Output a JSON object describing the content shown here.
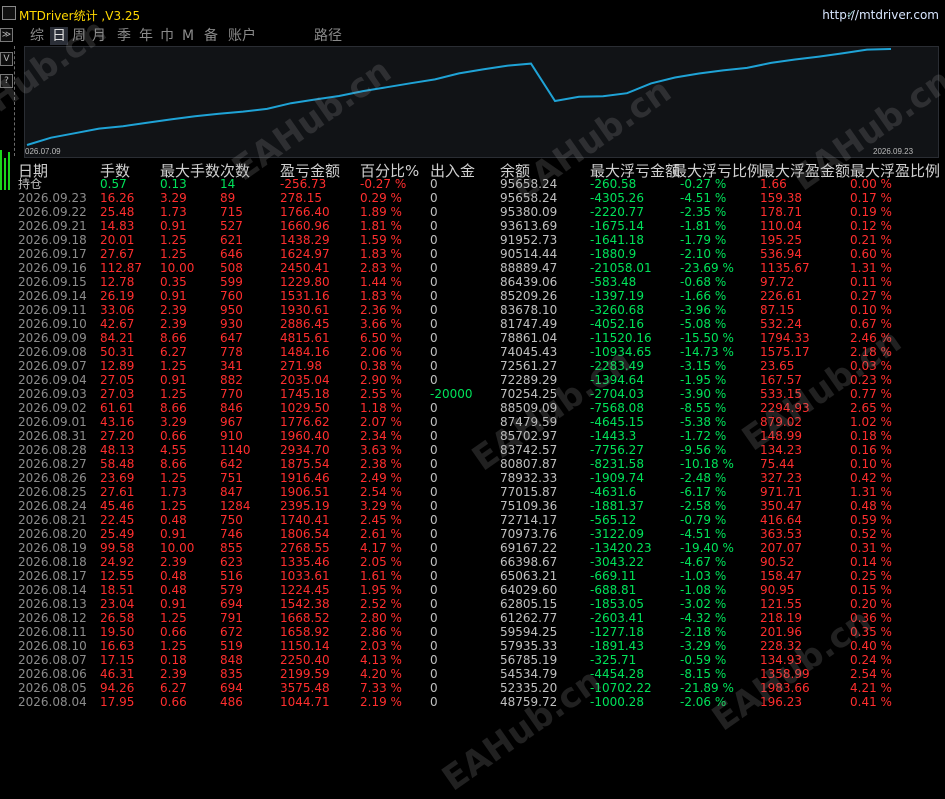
{
  "window": {
    "title": "MTDriver统计 ,V3.25",
    "url": "http://mtdriver.com"
  },
  "toolbar": {
    "tabs": [
      {
        "label": "综",
        "active": false
      },
      {
        "label": "日",
        "active": true
      },
      {
        "label": "周",
        "active": false
      },
      {
        "label": "月",
        "active": false
      },
      {
        "label": "季",
        "active": false
      },
      {
        "label": "年",
        "active": false
      },
      {
        "label": "巾",
        "active": false
      },
      {
        "label": "M",
        "active": false
      },
      {
        "label": "备",
        "active": false
      },
      {
        "label": "账户",
        "active": false
      },
      {
        "label": "路径",
        "active": false
      }
    ],
    "side_buttons": [
      "≫",
      "V",
      "?"
    ]
  },
  "chart_data": {
    "type": "line",
    "x_start_label": "026.07.09",
    "x_end_label": "2026.09.23",
    "series": [
      {
        "values": [
          48759.72,
          52335.2,
          54534.79,
          56785.19,
          57935.33,
          59594.25,
          61262.77,
          62805.15,
          64029.6,
          65063.21,
          66398.67,
          69167.22,
          70973.76,
          72714.17,
          75109.36,
          77015.87,
          78932.33,
          80807.87,
          83742.57,
          85702.97,
          87479.59,
          88509.09,
          70254.25,
          72289.29,
          72561.27,
          74045.43,
          78861.04,
          81747.49,
          83678.1,
          85209.26,
          86439.06,
          88889.47,
          90514.44,
          91952.73,
          93613.69,
          95380.09,
          95658.24
        ]
      }
    ],
    "color": "#1fa3d6"
  },
  "table": {
    "headers": [
      "日期",
      "手数",
      "最大手数",
      "次数",
      "盈亏金额",
      "百分比%",
      "出入金",
      "余额",
      "最大浮亏金额",
      "最大浮亏比例",
      "最大浮盈金额",
      "最大浮盈比例"
    ],
    "summary": {
      "date": "持仓",
      "lots": "0.57",
      "max_lots": "0.13",
      "count": "14",
      "pnl": "-256.73",
      "pct": "-0.27 %",
      "inout": "0",
      "balance": "95658.24",
      "max_float_loss": "-260.58",
      "max_float_loss_pct": "-0.27 %",
      "max_float_profit": "1.66",
      "max_float_profit_pct": "0.00 %"
    },
    "rows": [
      {
        "date": "2026.09.23",
        "lots": "16.26",
        "max_lots": "3.29",
        "count": "89",
        "pnl": "278.15",
        "pct": "0.29 %",
        "inout": "0",
        "balance": "95658.24",
        "fl": "-4305.26",
        "flp": "-4.51 %",
        "fp": "159.38",
        "fpp": "0.17 %"
      },
      {
        "date": "2026.09.22",
        "lots": "25.48",
        "max_lots": "1.73",
        "count": "715",
        "pnl": "1766.40",
        "pct": "1.89 %",
        "inout": "0",
        "balance": "95380.09",
        "fl": "-2220.77",
        "flp": "-2.35 %",
        "fp": "178.71",
        "fpp": "0.19 %"
      },
      {
        "date": "2026.09.21",
        "lots": "14.83",
        "max_lots": "0.91",
        "count": "527",
        "pnl": "1660.96",
        "pct": "1.81 %",
        "inout": "0",
        "balance": "93613.69",
        "fl": "-1675.14",
        "flp": "-1.81 %",
        "fp": "110.04",
        "fpp": "0.12 %"
      },
      {
        "date": "2026.09.18",
        "lots": "20.01",
        "max_lots": "1.25",
        "count": "621",
        "pnl": "1438.29",
        "pct": "1.59 %",
        "inout": "0",
        "balance": "91952.73",
        "fl": "-1641.18",
        "flp": "-1.79 %",
        "fp": "195.25",
        "fpp": "0.21 %"
      },
      {
        "date": "2026.09.17",
        "lots": "27.67",
        "max_lots": "1.25",
        "count": "646",
        "pnl": "1624.97",
        "pct": "1.83 %",
        "inout": "0",
        "balance": "90514.44",
        "fl": "-1880.9",
        "flp": "-2.10 %",
        "fp": "536.94",
        "fpp": "0.60 %"
      },
      {
        "date": "2026.09.16",
        "lots": "112.87",
        "max_lots": "10.00",
        "count": "508",
        "pnl": "2450.41",
        "pct": "2.83 %",
        "inout": "0",
        "balance": "88889.47",
        "fl": "-21058.01",
        "flp": "-23.69 %",
        "fp": "1135.67",
        "fpp": "1.31 %"
      },
      {
        "date": "2026.09.15",
        "lots": "12.78",
        "max_lots": "0.35",
        "count": "599",
        "pnl": "1229.80",
        "pct": "1.44 %",
        "inout": "0",
        "balance": "86439.06",
        "fl": "-583.48",
        "flp": "-0.68 %",
        "fp": "97.72",
        "fpp": "0.11 %"
      },
      {
        "date": "2026.09.14",
        "lots": "26.19",
        "max_lots": "0.91",
        "count": "760",
        "pnl": "1531.16",
        "pct": "1.83 %",
        "inout": "0",
        "balance": "85209.26",
        "fl": "-1397.19",
        "flp": "-1.66 %",
        "fp": "226.61",
        "fpp": "0.27 %"
      },
      {
        "date": "2026.09.11",
        "lots": "33.06",
        "max_lots": "2.39",
        "count": "950",
        "pnl": "1930.61",
        "pct": "2.36 %",
        "inout": "0",
        "balance": "83678.10",
        "fl": "-3260.68",
        "flp": "-3.96 %",
        "fp": "87.15",
        "fpp": "0.10 %"
      },
      {
        "date": "2026.09.10",
        "lots": "42.67",
        "max_lots": "2.39",
        "count": "930",
        "pnl": "2886.45",
        "pct": "3.66 %",
        "inout": "0",
        "balance": "81747.49",
        "fl": "-4052.16",
        "flp": "-5.08 %",
        "fp": "532.24",
        "fpp": "0.67 %"
      },
      {
        "date": "2026.09.09",
        "lots": "84.21",
        "max_lots": "8.66",
        "count": "647",
        "pnl": "4815.61",
        "pct": "6.50 %",
        "inout": "0",
        "balance": "78861.04",
        "fl": "-11520.16",
        "flp": "-15.50 %",
        "fp": "1794.33",
        "fpp": "2.46 %"
      },
      {
        "date": "2026.09.08",
        "lots": "50.31",
        "max_lots": "6.27",
        "count": "778",
        "pnl": "1484.16",
        "pct": "2.06 %",
        "inout": "0",
        "balance": "74045.43",
        "fl": "-10934.65",
        "flp": "-14.73 %",
        "fp": "1575.17",
        "fpp": "2.18 %"
      },
      {
        "date": "2026.09.07",
        "lots": "12.89",
        "max_lots": "1.25",
        "count": "341",
        "pnl": "271.98",
        "pct": "0.38 %",
        "inout": "0",
        "balance": "72561.27",
        "fl": "-2283.49",
        "flp": "-3.15 %",
        "fp": "23.65",
        "fpp": "0.03 %"
      },
      {
        "date": "2026.09.04",
        "lots": "27.05",
        "max_lots": "0.91",
        "count": "882",
        "pnl": "2035.04",
        "pct": "2.90 %",
        "inout": "0",
        "balance": "72289.29",
        "fl": "-1394.64",
        "flp": "-1.95 %",
        "fp": "167.57",
        "fpp": "0.23 %"
      },
      {
        "date": "2026.09.03",
        "lots": "27.03",
        "max_lots": "1.25",
        "count": "770",
        "pnl": "1745.18",
        "pct": "2.55 %",
        "inout": "-20000",
        "balance": "70254.25",
        "fl": "-2704.03",
        "flp": "-3.90 %",
        "fp": "533.15",
        "fpp": "0.77 %"
      },
      {
        "date": "2026.09.02",
        "lots": "61.61",
        "max_lots": "8.66",
        "count": "846",
        "pnl": "1029.50",
        "pct": "1.18 %",
        "inout": "0",
        "balance": "88509.09",
        "fl": "-7568.08",
        "flp": "-8.55 %",
        "fp": "2294.93",
        "fpp": "2.65 %"
      },
      {
        "date": "2026.09.01",
        "lots": "43.16",
        "max_lots": "3.29",
        "count": "967",
        "pnl": "1776.62",
        "pct": "2.07 %",
        "inout": "0",
        "balance": "87479.59",
        "fl": "-4645.15",
        "flp": "-5.38 %",
        "fp": "879.02",
        "fpp": "1.02 %"
      },
      {
        "date": "2026.08.31",
        "lots": "27.20",
        "max_lots": "0.66",
        "count": "910",
        "pnl": "1960.40",
        "pct": "2.34 %",
        "inout": "0",
        "balance": "85702.97",
        "fl": "-1443.3",
        "flp": "-1.72 %",
        "fp": "148.99",
        "fpp": "0.18 %"
      },
      {
        "date": "2026.08.28",
        "lots": "48.13",
        "max_lots": "4.55",
        "count": "1140",
        "pnl": "2934.70",
        "pct": "3.63 %",
        "inout": "0",
        "balance": "83742.57",
        "fl": "-7756.27",
        "flp": "-9.56 %",
        "fp": "134.23",
        "fpp": "0.16 %"
      },
      {
        "date": "2026.08.27",
        "lots": "58.48",
        "max_lots": "8.66",
        "count": "642",
        "pnl": "1875.54",
        "pct": "2.38 %",
        "inout": "0",
        "balance": "80807.87",
        "fl": "-8231.58",
        "flp": "-10.18 %",
        "fp": "75.44",
        "fpp": "0.10 %"
      },
      {
        "date": "2026.08.26",
        "lots": "23.69",
        "max_lots": "1.25",
        "count": "751",
        "pnl": "1916.46",
        "pct": "2.49 %",
        "inout": "0",
        "balance": "78932.33",
        "fl": "-1909.74",
        "flp": "-2.48 %",
        "fp": "327.23",
        "fpp": "0.42 %"
      },
      {
        "date": "2026.08.25",
        "lots": "27.61",
        "max_lots": "1.73",
        "count": "847",
        "pnl": "1906.51",
        "pct": "2.54 %",
        "inout": "0",
        "balance": "77015.87",
        "fl": "-4631.6",
        "flp": "-6.17 %",
        "fp": "971.71",
        "fpp": "1.31 %"
      },
      {
        "date": "2026.08.24",
        "lots": "45.46",
        "max_lots": "1.25",
        "count": "1284",
        "pnl": "2395.19",
        "pct": "3.29 %",
        "inout": "0",
        "balance": "75109.36",
        "fl": "-1881.37",
        "flp": "-2.58 %",
        "fp": "350.47",
        "fpp": "0.48 %"
      },
      {
        "date": "2026.08.21",
        "lots": "22.45",
        "max_lots": "0.48",
        "count": "750",
        "pnl": "1740.41",
        "pct": "2.45 %",
        "inout": "0",
        "balance": "72714.17",
        "fl": "-565.12",
        "flp": "-0.79 %",
        "fp": "416.64",
        "fpp": "0.59 %"
      },
      {
        "date": "2026.08.20",
        "lots": "25.49",
        "max_lots": "0.91",
        "count": "746",
        "pnl": "1806.54",
        "pct": "2.61 %",
        "inout": "0",
        "balance": "70973.76",
        "fl": "-3122.09",
        "flp": "-4.51 %",
        "fp": "363.53",
        "fpp": "0.52 %"
      },
      {
        "date": "2026.08.19",
        "lots": "99.58",
        "max_lots": "10.00",
        "count": "855",
        "pnl": "2768.55",
        "pct": "4.17 %",
        "inout": "0",
        "balance": "69167.22",
        "fl": "-13420.23",
        "flp": "-19.40 %",
        "fp": "207.07",
        "fpp": "0.31 %"
      },
      {
        "date": "2026.08.18",
        "lots": "24.92",
        "max_lots": "2.39",
        "count": "623",
        "pnl": "1335.46",
        "pct": "2.05 %",
        "inout": "0",
        "balance": "66398.67",
        "fl": "-3043.22",
        "flp": "-4.67 %",
        "fp": "90.52",
        "fpp": "0.14 %"
      },
      {
        "date": "2026.08.17",
        "lots": "12.55",
        "max_lots": "0.48",
        "count": "516",
        "pnl": "1033.61",
        "pct": "1.61 %",
        "inout": "0",
        "balance": "65063.21",
        "fl": "-669.11",
        "flp": "-1.03 %",
        "fp": "158.47",
        "fpp": "0.25 %"
      },
      {
        "date": "2026.08.14",
        "lots": "18.51",
        "max_lots": "0.48",
        "count": "579",
        "pnl": "1224.45",
        "pct": "1.95 %",
        "inout": "0",
        "balance": "64029.60",
        "fl": "-688.81",
        "flp": "-1.08 %",
        "fp": "90.95",
        "fpp": "0.15 %"
      },
      {
        "date": "2026.08.13",
        "lots": "23.04",
        "max_lots": "0.91",
        "count": "694",
        "pnl": "1542.38",
        "pct": "2.52 %",
        "inout": "0",
        "balance": "62805.15",
        "fl": "-1853.05",
        "flp": "-3.02 %",
        "fp": "121.55",
        "fpp": "0.20 %"
      },
      {
        "date": "2026.08.12",
        "lots": "26.58",
        "max_lots": "1.25",
        "count": "791",
        "pnl": "1668.52",
        "pct": "2.80 %",
        "inout": "0",
        "balance": "61262.77",
        "fl": "-2603.41",
        "flp": "-4.32 %",
        "fp": "218.19",
        "fpp": "0.36 %"
      },
      {
        "date": "2026.08.11",
        "lots": "19.50",
        "max_lots": "0.66",
        "count": "672",
        "pnl": "1658.92",
        "pct": "2.86 %",
        "inout": "0",
        "balance": "59594.25",
        "fl": "-1277.18",
        "flp": "-2.18 %",
        "fp": "201.96",
        "fpp": "0.35 %"
      },
      {
        "date": "2026.08.10",
        "lots": "16.63",
        "max_lots": "1.25",
        "count": "519",
        "pnl": "1150.14",
        "pct": "2.03 %",
        "inout": "0",
        "balance": "57935.33",
        "fl": "-1891.43",
        "flp": "-3.29 %",
        "fp": "228.32",
        "fpp": "0.40 %"
      },
      {
        "date": "2026.08.07",
        "lots": "17.15",
        "max_lots": "0.18",
        "count": "848",
        "pnl": "2250.40",
        "pct": "4.13 %",
        "inout": "0",
        "balance": "56785.19",
        "fl": "-325.71",
        "flp": "-0.59 %",
        "fp": "134.93",
        "fpp": "0.24 %"
      },
      {
        "date": "2026.08.06",
        "lots": "46.31",
        "max_lots": "2.39",
        "count": "835",
        "pnl": "2199.59",
        "pct": "4.20 %",
        "inout": "0",
        "balance": "54534.79",
        "fl": "-4454.28",
        "flp": "-8.15 %",
        "fp": "1358.99",
        "fpp": "2.54 %"
      },
      {
        "date": "2026.08.05",
        "lots": "94.26",
        "max_lots": "6.27",
        "count": "694",
        "pnl": "3575.48",
        "pct": "7.33 %",
        "inout": "0",
        "balance": "52335.20",
        "fl": "-10702.22",
        "flp": "-21.89 %",
        "fp": "1983.66",
        "fpp": "4.21 %"
      },
      {
        "date": "2026.08.04",
        "lots": "17.95",
        "max_lots": "0.66",
        "count": "486",
        "pnl": "1044.71",
        "pct": "2.19 %",
        "inout": "0",
        "balance": "48759.72",
        "fl": "-1000.28",
        "flp": "-2.06 %",
        "fp": "196.23",
        "fpp": "0.41 %"
      }
    ]
  },
  "watermark": "EAHub.cn"
}
